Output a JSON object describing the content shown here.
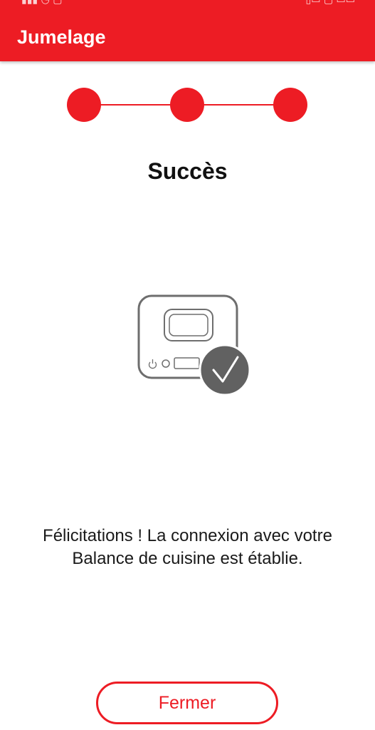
{
  "app_bar": {
    "title": "Jumelage",
    "background_color": "#ed1c24"
  },
  "stepper": {
    "steps_total": 3,
    "steps_completed": 3,
    "color": "#ed1c24"
  },
  "heading": "Succès",
  "illustration": {
    "device": "kitchen-scale-icon",
    "badge": "checkmark-icon",
    "badge_color": "#616161"
  },
  "message": {
    "line1": "Félicitations ! La connexion avec votre",
    "line2": "Balance de cuisine est établie."
  },
  "close_button": {
    "label": "Fermer",
    "accent_color": "#ed1c24"
  }
}
